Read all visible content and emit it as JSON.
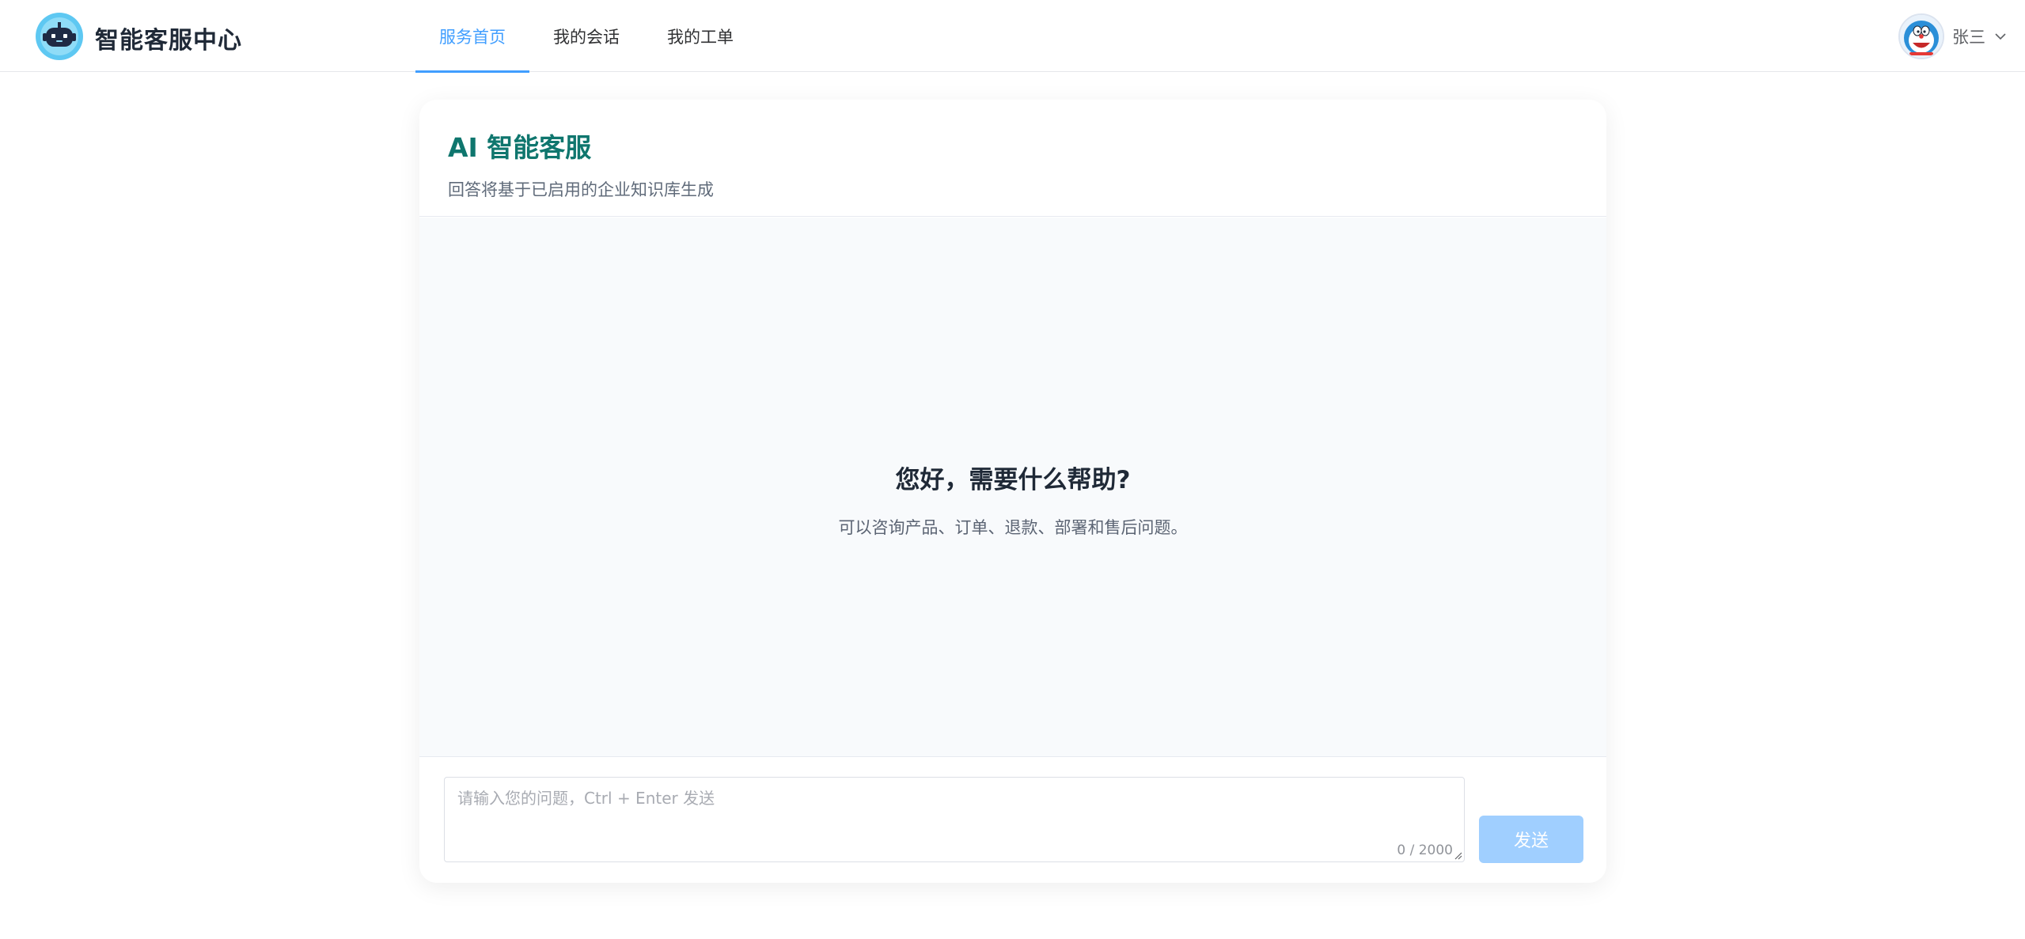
{
  "header": {
    "brand": "智能客服中心",
    "nav": [
      {
        "label": "服务首页",
        "active": true
      },
      {
        "label": "我的会话",
        "active": false
      },
      {
        "label": "我的工单",
        "active": false
      }
    ],
    "user": {
      "name": "张三"
    }
  },
  "card": {
    "title": "AI 智能客服",
    "subtitle": "回答将基于已启用的企业知识库生成"
  },
  "welcome": {
    "title": "您好，需要什么帮助?",
    "subtitle": "可以咨询产品、订单、退款、部署和售后问题。"
  },
  "composer": {
    "value": "",
    "placeholder": "请输入您的问题，Ctrl + Enter 发送",
    "counter": "0 / 2000",
    "send_label": "发送"
  },
  "colors": {
    "accent": "#409eff",
    "title_teal": "#0f766e",
    "send_disabled": "#a0cfff",
    "chat_bg": "#f8fafc"
  },
  "icons": {
    "logo": "robot-icon",
    "user_menu": "chevron-down-icon"
  }
}
